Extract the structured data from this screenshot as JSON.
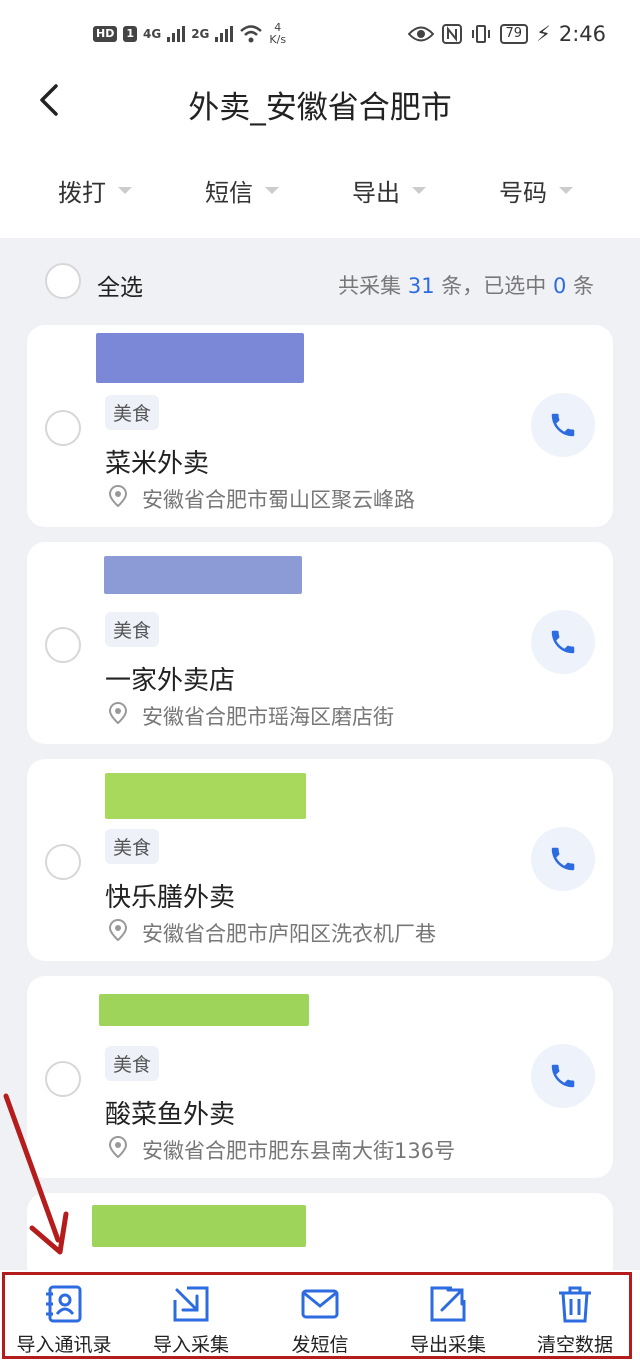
{
  "status_bar": {
    "hd": "HD",
    "sim": "1",
    "net1": "4G",
    "net2": "2G",
    "speed_value": "4",
    "speed_unit": "K/s",
    "battery": "79",
    "time": "2:46"
  },
  "header": {
    "title": "外卖_安徽省合肥市"
  },
  "filters": [
    {
      "label": "拨打"
    },
    {
      "label": "短信"
    },
    {
      "label": "导出"
    },
    {
      "label": "号码"
    }
  ],
  "select_all": {
    "label": "全选",
    "count_prefix": "共采集",
    "total": "31",
    "count_mid": "条，已选中",
    "selected": "0",
    "count_suffix": "条"
  },
  "cards": [
    {
      "tag": "美食",
      "name": "菜米外卖",
      "address": "安徽省合肥市蜀山区聚云峰路"
    },
    {
      "tag": "美食",
      "name": "一家外卖店",
      "address": "安徽省合肥市瑶海区磨店街"
    },
    {
      "tag": "美食",
      "name": "快乐膳外卖",
      "address": "安徽省合肥市庐阳区洗衣机厂巷"
    },
    {
      "tag": "美食",
      "name": "酸菜鱼外卖",
      "address": "安徽省合肥市肥东县南大街136号"
    }
  ],
  "bottom_bar": [
    {
      "label": "导入通讯录",
      "icon": "contact-import-icon"
    },
    {
      "label": "导入采集",
      "icon": "import-arrow-icon"
    },
    {
      "label": "发短信",
      "icon": "mail-icon"
    },
    {
      "label": "导出采集",
      "icon": "export-arrow-icon"
    },
    {
      "label": "清空数据",
      "icon": "trash-icon"
    }
  ],
  "colors": {
    "accent": "#2d6be0",
    "annotation": "#b51c1c",
    "page_bg": "#f0f1f5"
  }
}
